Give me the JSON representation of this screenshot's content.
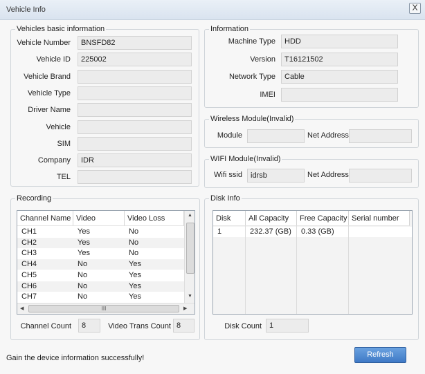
{
  "window": {
    "title": "Vehicle Info",
    "close": "X"
  },
  "vehicle": {
    "title": "Vehicles basic information",
    "fields": [
      {
        "label": "Vehicle Number",
        "value": "BNSFD82"
      },
      {
        "label": "Vehicle ID",
        "value": "225002"
      },
      {
        "label": "Vehicle Brand",
        "value": ""
      },
      {
        "label": "Vehicle Type",
        "value": ""
      },
      {
        "label": "Driver Name",
        "value": ""
      },
      {
        "label": "Vehicle",
        "value": ""
      },
      {
        "label": "SIM",
        "value": ""
      },
      {
        "label": "Company",
        "value": "IDR"
      },
      {
        "label": "TEL",
        "value": ""
      }
    ]
  },
  "information": {
    "title": "Information",
    "fields": [
      {
        "label": "Machine Type",
        "value": "HDD"
      },
      {
        "label": "Version",
        "value": "T16121502"
      },
      {
        "label": "Network Type",
        "value": "Cable"
      },
      {
        "label": "IMEI",
        "value": ""
      }
    ]
  },
  "wireless": {
    "title": "Wireless Module(Invalid)",
    "module_label": "Module",
    "module_value": "",
    "net_label": "Net Address",
    "net_value": ""
  },
  "wifi": {
    "title": "WIFI Module(Invalid)",
    "ssid_label": "Wifi ssid",
    "ssid_value": "idrsb",
    "net_label": "Net Address",
    "net_value": ""
  },
  "recording": {
    "title": "Recording",
    "columns": [
      "Channel Name",
      "Video",
      "Video Loss"
    ],
    "rows": [
      [
        "CH1",
        "Yes",
        "No"
      ],
      [
        "CH2",
        "Yes",
        "No"
      ],
      [
        "CH3",
        "Yes",
        "No"
      ],
      [
        "CH4",
        "No",
        "Yes"
      ],
      [
        "CH5",
        "No",
        "Yes"
      ],
      [
        "CH6",
        "No",
        "Yes"
      ],
      [
        "CH7",
        "No",
        "Yes"
      ]
    ],
    "channel_count_label": "Channel Count",
    "channel_count": "8",
    "trans_count_label": "Video Trans Count",
    "trans_count": "8",
    "hscroll_grip": "III"
  },
  "disk": {
    "title": "Disk Info",
    "columns": [
      "Disk",
      "All Capacity",
      "Free Capacity",
      "Serial number"
    ],
    "rows": [
      [
        "1",
        "232.37 (GB)",
        "0.33 (GB)",
        ""
      ]
    ],
    "disk_count_label": "Disk Count",
    "disk_count": "1"
  },
  "footer": {
    "status": "Gain the device information successfully!",
    "refresh": "Refresh"
  }
}
